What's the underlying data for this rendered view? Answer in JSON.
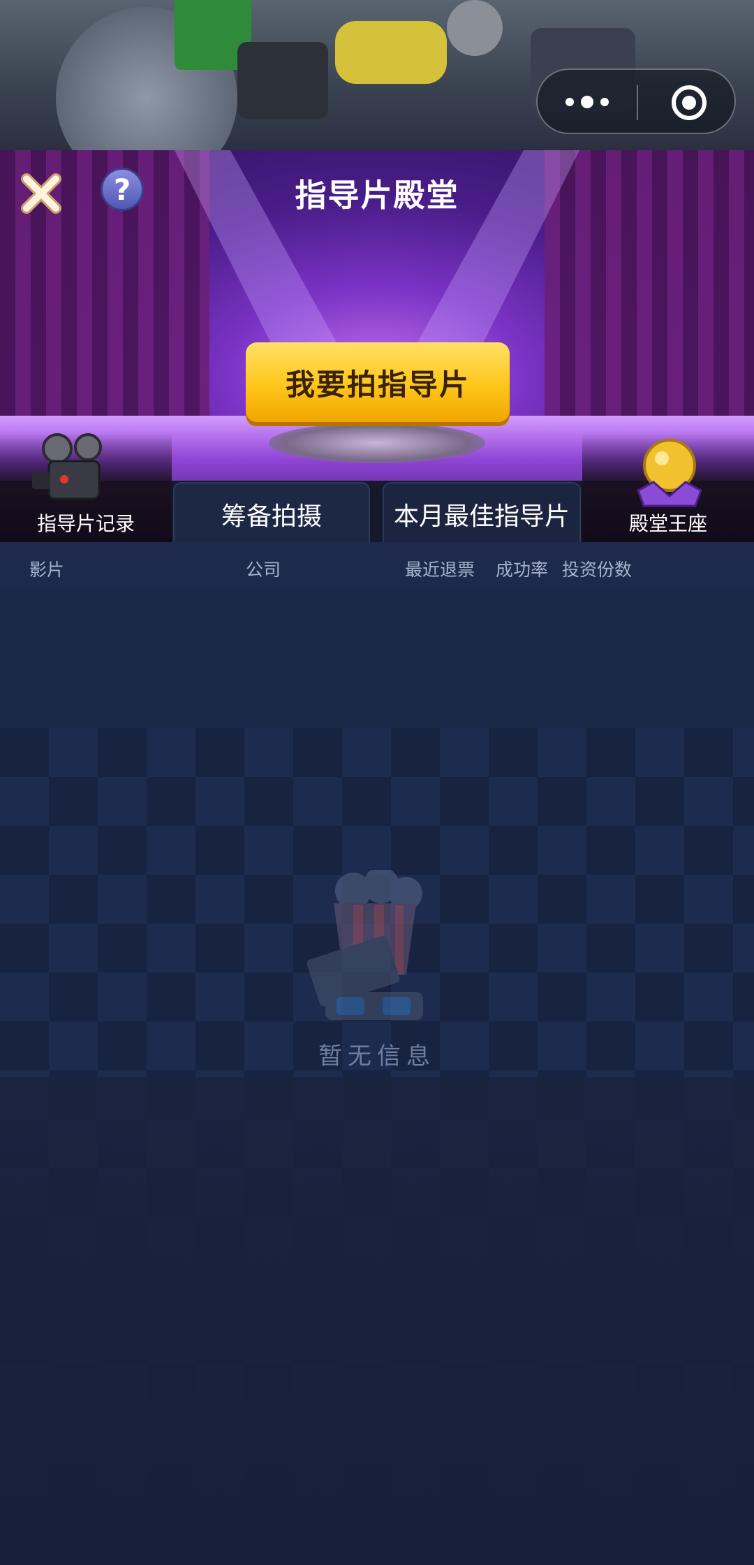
{
  "header": {
    "title": "指导片殿堂"
  },
  "main_button": {
    "label": "我要拍指导片"
  },
  "left_corner": {
    "label": "指导片记录"
  },
  "right_corner": {
    "label": "殿堂王座"
  },
  "tabs": [
    {
      "label": "筹备拍摄"
    },
    {
      "label": "本月最佳指导片"
    }
  ],
  "columns": [
    "影片",
    "公司",
    "最近退票",
    "成功率",
    "投资份数"
  ],
  "empty_state": {
    "text": "暂无信息"
  },
  "icons": {
    "close": "close-icon",
    "help": "help-icon",
    "more": "more-dots-icon",
    "target": "target-icon",
    "projector": "film-projector-icon",
    "throne": "golden-orb-crown-icon",
    "popcorn": "popcorn-icon"
  },
  "colors": {
    "button_yellow": "#ffc61a",
    "stage_purple": "#7a33c4",
    "background": "#1a2747"
  }
}
